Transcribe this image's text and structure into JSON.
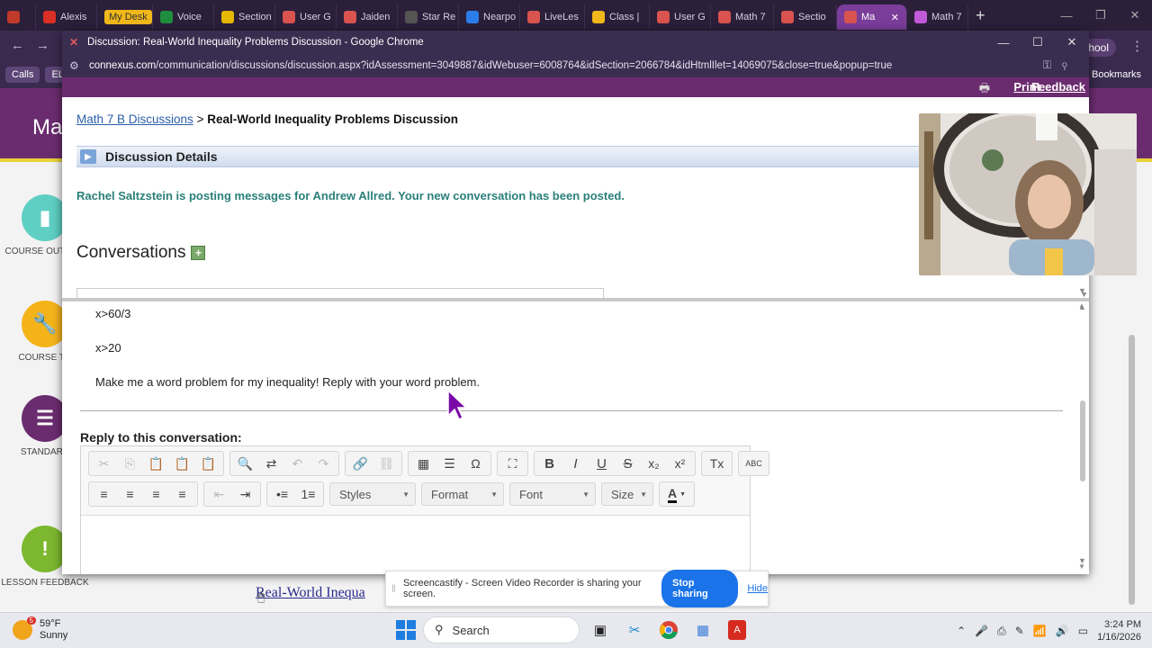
{
  "tabs": [
    {
      "label": "",
      "icon": "record-icon",
      "color": "#c0392b",
      "active": false
    },
    {
      "label": "Alexis",
      "icon": "gmail-icon",
      "color": "#d93025",
      "active": false
    },
    {
      "label": "My Desk",
      "icon": "",
      "color": "#f0b81a",
      "active": false
    },
    {
      "label": "Voice",
      "icon": "phone-icon",
      "color": "#1e8e3e",
      "active": false
    },
    {
      "label": "Section",
      "icon": "chart-icon",
      "color": "#e6b800",
      "active": false
    },
    {
      "label": "User G",
      "icon": "x-icon",
      "color": "#d9534f",
      "active": false
    },
    {
      "label": "Jaiden",
      "icon": "x-icon",
      "color": "#d9534f",
      "active": false
    },
    {
      "label": "Star Re",
      "icon": "star-icon",
      "color": "#555555",
      "active": false
    },
    {
      "label": "Nearpo",
      "icon": "nearpod-icon",
      "color": "#2b7de9",
      "active": false
    },
    {
      "label": "LiveLes",
      "icon": "x-icon",
      "color": "#d9534f",
      "active": false
    },
    {
      "label": "Class |",
      "icon": "folder-icon",
      "color": "#f0b81a",
      "active": false
    },
    {
      "label": "User G",
      "icon": "x-icon",
      "color": "#d9534f",
      "active": false
    },
    {
      "label": "Math 7",
      "icon": "x-icon",
      "color": "#d9534f",
      "active": false
    },
    {
      "label": "Sectio",
      "icon": "x-icon",
      "color": "#d9534f",
      "active": false
    },
    {
      "label": "Ma",
      "icon": "x-icon",
      "color": "#d9534f",
      "active": true
    },
    {
      "label": "Math 7",
      "icon": "doc-icon",
      "color": "#c15ad8",
      "active": false
    }
  ],
  "parent": {
    "school_label": "chool",
    "bookmark_chips": [
      "Calls",
      "ELop"
    ],
    "all_bookmarks": "All Bookmarks",
    "page_title": "Ma",
    "side_items": [
      {
        "label": "COURSE OUTLINE",
        "color": "#5fcfc3"
      },
      {
        "label": "COURSE TO",
        "color": "#f5b31a"
      },
      {
        "label": "STANDARD",
        "color": "#6b2c6f"
      },
      {
        "label": "LESSON FEEDBACK",
        "color": "#7cb82f"
      }
    ],
    "bottom_link": "Real-World Inequa"
  },
  "popup": {
    "window_title": "Discussion: Real-World Inequality Problems Discussion - Google Chrome",
    "url_host": "connexus.com",
    "url_path": "/communication/discussions/discussion.aspx?idAssessment=3049887&idWebuser=6008764&idSection=2066784&idHtmlIlet=14069075&close=true&popup=true",
    "print_label": "Print",
    "feedback_label": "Feedback",
    "breadcrumb_link": "Math 7 B Discussions",
    "breadcrumb_sep": ">",
    "breadcrumb_current": "Real-World Inequality Problems Discussion",
    "details_label": "Discussion Details",
    "notice": "Rachel Saltzstein is posting messages for Andrew Allred. Your new conversation has been posted.",
    "conversations_heading": "Conversations",
    "message_lines": [
      "x>60/3",
      "x>20",
      "Make me a word problem for my inequality! Reply with your word problem."
    ],
    "reply_heading": "Reply to this conversation:",
    "editor": {
      "row1_groups": [
        [
          {
            "name": "cut-icon",
            "glyph": "✂",
            "dim": true
          },
          {
            "name": "copy-icon",
            "glyph": "⎘",
            "dim": true
          },
          {
            "name": "paste-icon",
            "glyph": "📋",
            "dim": false
          },
          {
            "name": "paste-text-icon",
            "glyph": "📋",
            "dim": false
          },
          {
            "name": "paste-word-icon",
            "glyph": "📋",
            "dim": false
          }
        ],
        [
          {
            "name": "find-icon",
            "glyph": "🔍",
            "dim": false
          },
          {
            "name": "replace-icon",
            "glyph": "⇄",
            "dim": false
          },
          {
            "name": "undo-icon",
            "glyph": "↶",
            "dim": true
          },
          {
            "name": "redo-icon",
            "glyph": "↷",
            "dim": true
          }
        ],
        [
          {
            "name": "link-icon",
            "glyph": "🔗",
            "dim": false
          },
          {
            "name": "unlink-icon",
            "glyph": "⛓",
            "dim": true
          }
        ],
        [
          {
            "name": "table-icon",
            "glyph": "▦",
            "dim": false
          },
          {
            "name": "horizontal-line-icon",
            "glyph": "☰",
            "dim": false
          },
          {
            "name": "special-char-icon",
            "glyph": "Ω",
            "dim": false
          }
        ],
        [
          {
            "name": "maximize-icon",
            "glyph": "⛶",
            "dim": false
          }
        ],
        [
          {
            "name": "bold-icon",
            "glyph": "B",
            "dim": false
          },
          {
            "name": "italic-icon",
            "glyph": "I",
            "dim": false
          },
          {
            "name": "underline-icon",
            "glyph": "U",
            "dim": false
          },
          {
            "name": "strike-icon",
            "glyph": "S",
            "dim": false
          },
          {
            "name": "subscript-icon",
            "glyph": "x₂",
            "dim": false
          },
          {
            "name": "superscript-icon",
            "glyph": "x²",
            "dim": false
          }
        ],
        [
          {
            "name": "remove-format-icon",
            "glyph": "Tx",
            "dim": false
          }
        ],
        [
          {
            "name": "spellcheck-icon",
            "glyph": "ABC",
            "dim": false
          }
        ]
      ],
      "row2_groups": [
        [
          {
            "name": "align-left-icon",
            "glyph": "≡",
            "dim": false
          },
          {
            "name": "align-center-icon",
            "glyph": "≡",
            "dim": false
          },
          {
            "name": "align-right-icon",
            "glyph": "≡",
            "dim": false
          },
          {
            "name": "justify-icon",
            "glyph": "≡",
            "dim": false
          }
        ],
        [
          {
            "name": "outdent-icon",
            "glyph": "⇤",
            "dim": true
          },
          {
            "name": "indent-icon",
            "glyph": "⇥",
            "dim": false
          }
        ],
        [
          {
            "name": "bullet-list-icon",
            "glyph": "•≡",
            "dim": false
          },
          {
            "name": "numbered-list-icon",
            "glyph": "1≡",
            "dim": false
          }
        ]
      ],
      "combos": [
        "Styles",
        "Format",
        "Font",
        "Size"
      ],
      "text_color_glyph": "A"
    }
  },
  "screencastify": {
    "message": "Screencastify - Screen Video Recorder is sharing your screen.",
    "stop_label": "Stop sharing",
    "hide_label": "Hide"
  },
  "taskbar": {
    "weather_badge": "5",
    "temperature": "59°F",
    "condition": "Sunny",
    "search_label": "Search",
    "time": "3:24 PM",
    "date": "1/16/2026"
  }
}
